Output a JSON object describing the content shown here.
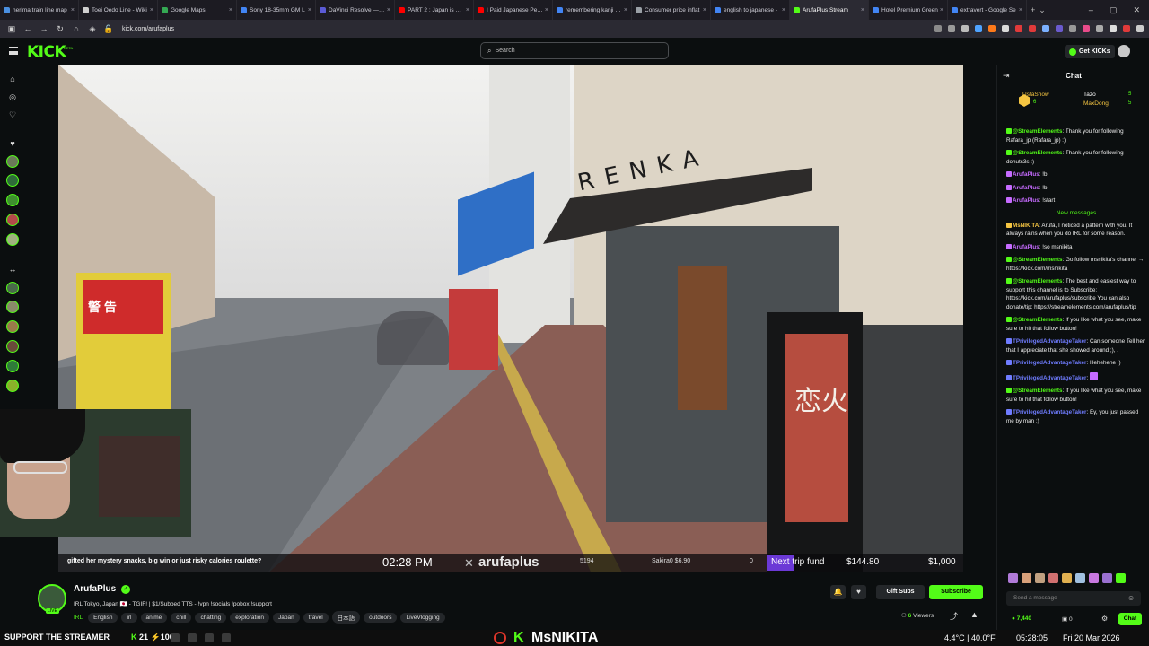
{
  "browser": {
    "tabs": [
      {
        "title": "nerima train line map",
        "color": "#4a90e2"
      },
      {
        "title": "Toei Ōedo Line - Wiki",
        "color": "#cfcfcf"
      },
      {
        "title": "Google Maps",
        "color": "#34a853"
      },
      {
        "title": "Sony 18-35mm GM L",
        "color": "#4285f4"
      },
      {
        "title": "DaVinci Resolve — M",
        "color": "#5b5bd6"
      },
      {
        "title": "PART 2 : Japan is curr",
        "color": "#ff0000"
      },
      {
        "title": "I Paid Japanese Peopl",
        "color": "#ff0000"
      },
      {
        "title": "remembering kanji - C",
        "color": "#4285f4"
      },
      {
        "title": "Consumer price inflat",
        "color": "#9aa0a6"
      },
      {
        "title": "english to japanese -",
        "color": "#4285f4"
      },
      {
        "title": "ArufaPlus Stream",
        "color": "#53fc18",
        "active": true
      },
      {
        "title": "Hotel Premium Green",
        "color": "#4285f4"
      },
      {
        "title": "extravert - Google Se",
        "color": "#4285f4"
      }
    ],
    "url": "kick.com/arufaplus"
  },
  "header": {
    "logo": "KICK",
    "logo_sup": "BETA",
    "search_placeholder": "Search",
    "get_kicks": "Get KICKs"
  },
  "video": {
    "storefront_sign": "RENKA",
    "warning_sign": "警 告",
    "kiosk_text": "恋火"
  },
  "overlay": {
    "ticker": "gifted her mystery snacks, big win or just risky calories roulette?",
    "time": "02:28 PM",
    "channel": "arufaplus",
    "sub_count": "5194",
    "tip": "Sakira0 $6.90",
    "bits": "0",
    "goal_label": "Next trip fund",
    "goal_current": "$144.80",
    "goal_target": "$1,000"
  },
  "channel": {
    "name": "ArufaPlus",
    "live": "LIVE",
    "title": "IRL Tokyo, Japan 🇯🇵 - TGIF! | $1/Subbed TTS - !vpn !socials !pobox !support",
    "category": "IRL",
    "tags": [
      "English",
      "irl",
      "anime",
      "chill",
      "chatting",
      "exploration",
      "Japan",
      "travel",
      "日本語",
      "outdoors",
      "LiveVlogging"
    ],
    "gift_subs": "Gift Subs",
    "subscribe": "Subscribe",
    "viewers_count": "6",
    "viewers_label": "Viewers"
  },
  "chat": {
    "title": "Chat",
    "top_gifters": [
      {
        "name": "UstaShow",
        "count": "6"
      },
      {
        "name": "Tazo",
        "count": "5"
      },
      {
        "name": "MaxDong",
        "count": "5"
      }
    ],
    "messages_before": [
      {
        "user": "@StreamElements",
        "color": "#53fc18",
        "text": "Thank you for following Rafara_jp (Rafara_jp) :)"
      },
      {
        "user": "@StreamElements",
        "color": "#53fc18",
        "text": "Thank you for following donuts3s :)"
      },
      {
        "user": "ArufaPlus",
        "color": "#c66bff",
        "text": "!b"
      },
      {
        "user": "ArufaPlus",
        "color": "#c66bff",
        "text": "!b"
      },
      {
        "user": "ArufaPlus",
        "color": "#c66bff",
        "text": "!start"
      }
    ],
    "divider": "New messages",
    "messages_after": [
      {
        "user": "MsNIKITA",
        "color": "#f5c542",
        "text": "Arufa, I noticed a pattern with you. It always rains when you do IRL for some reason."
      },
      {
        "user": "ArufaPlus",
        "color": "#c66bff",
        "text": "!so msnikita"
      },
      {
        "user": "@StreamElements",
        "color": "#53fc18",
        "text": "Go follow msnikita's channel → https://kick.com/msnikita"
      },
      {
        "user": "@StreamElements",
        "color": "#53fc18",
        "text": "The best and easiest way to support this channel is to Subscribe: https://kick.com/arufaplus/subscribe You can also donate/tip: https://streamelements.com/arufaplus/tip"
      },
      {
        "user": "@StreamElements",
        "color": "#53fc18",
        "text": "If you like what you see, make sure to hit that follow button!"
      },
      {
        "user": "TPrivilegedAdvantageTaker",
        "color": "#6f7cff",
        "text": "Can someone Tell her that I appreciate that she showed around ;), ."
      },
      {
        "user": "TPrivilegedAdvantageTaker",
        "color": "#6f7cff",
        "text": "Hehehehe ;)"
      },
      {
        "user": "TPrivilegedAdvantageTaker",
        "color": "#6f7cff",
        "text": ""
      },
      {
        "user": "@StreamElements",
        "color": "#53fc18",
        "text": "If you like what you see, make sure to hit that follow button!"
      },
      {
        "user": "TPrivilegedAdvantageTaker",
        "color": "#6f7cff",
        "text": "Ey, you just passed me by man ;)"
      }
    ],
    "input_placeholder": "Send a message",
    "kicks": "7,440",
    "gifts": "0",
    "send_label": "Chat"
  },
  "taskbar": {
    "support_text": "SUPPORT THE STREAMER",
    "kicks_a": "21",
    "kicks_b": "100",
    "brand": "MsNIKITA",
    "temp": "4.4°C | 40.0°F",
    "clock": "05:28:05",
    "date": "Fri 20 Mar 2026"
  },
  "colors": {
    "kick_green": "#53fc18",
    "goal_purple": "#6b39d6",
    "background": "#0b0e0f"
  }
}
